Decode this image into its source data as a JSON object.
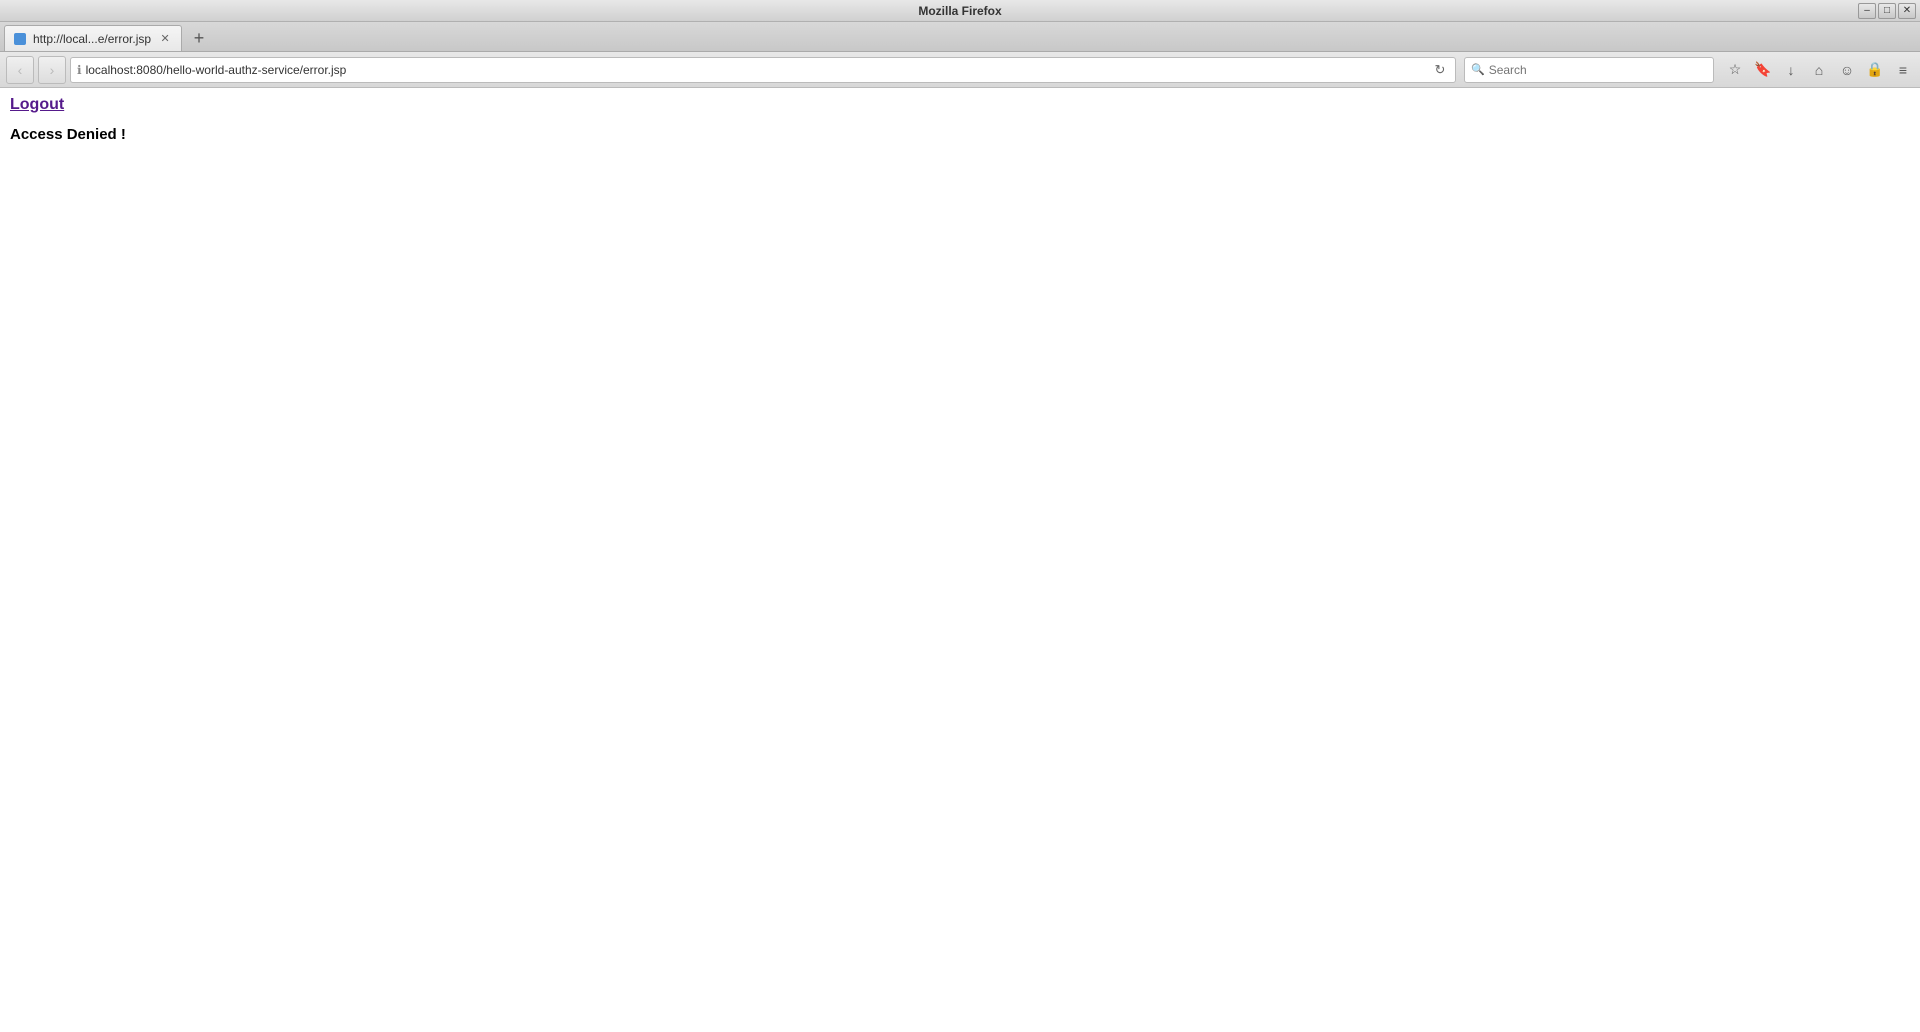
{
  "window": {
    "title": "Mozilla Firefox"
  },
  "tab": {
    "label": "http://local...e/error.jsp",
    "favicon_color": "#4a90d9"
  },
  "controls": {
    "minimize": "–",
    "maximize": "□",
    "close": "✕"
  },
  "nav": {
    "back_btn": "‹",
    "address": "localhost:8080/hello-world-authz-service/error.jsp",
    "security_icon": "ℹ",
    "reload_icon": "↻"
  },
  "search": {
    "placeholder": "Search"
  },
  "toolbar_icons": {
    "star": "☆",
    "bookmark": "📋",
    "download": "↓",
    "home": "⌂",
    "person": "☺",
    "lock": "🔒",
    "menu": "≡"
  },
  "page": {
    "logout_text": "Logout",
    "access_denied_text": "Access Denied !"
  }
}
